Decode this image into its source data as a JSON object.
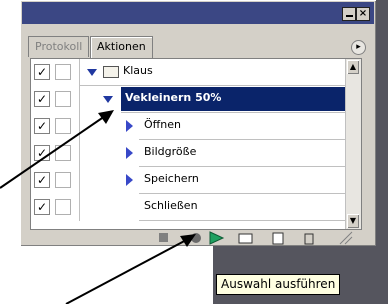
{
  "tabs": [
    {
      "label": "Protokoll",
      "active": false
    },
    {
      "label": "Aktionen",
      "active": true
    }
  ],
  "titlebar": {
    "minimize_icon": "minimize-icon",
    "close_symbol": "×"
  },
  "menu_symbol": "▸",
  "check_symbol": "✓",
  "rows": [
    {
      "label": "Klaus",
      "type": "set",
      "checked": true
    },
    {
      "label": "Vekleinern 50%",
      "type": "action",
      "checked": true,
      "selected": true
    },
    {
      "label": "Öffnen",
      "type": "command",
      "checked": true
    },
    {
      "label": "Bildgröße",
      "type": "command",
      "checked": true
    },
    {
      "label": "Speichern",
      "type": "command",
      "checked": true
    },
    {
      "label": "Schließen",
      "type": "command",
      "checked": true
    }
  ],
  "scroll": {
    "up": "▲",
    "down": "▼"
  },
  "bottom_icons": [
    "stop-icon",
    "record-icon",
    "play-icon",
    "new-set-icon",
    "new-action-icon",
    "trash-icon"
  ],
  "tooltip": "Auswahl ausführen",
  "colors": {
    "titlebar": "#3b4784",
    "selection": "#0a246a",
    "play": "#1fa060"
  }
}
